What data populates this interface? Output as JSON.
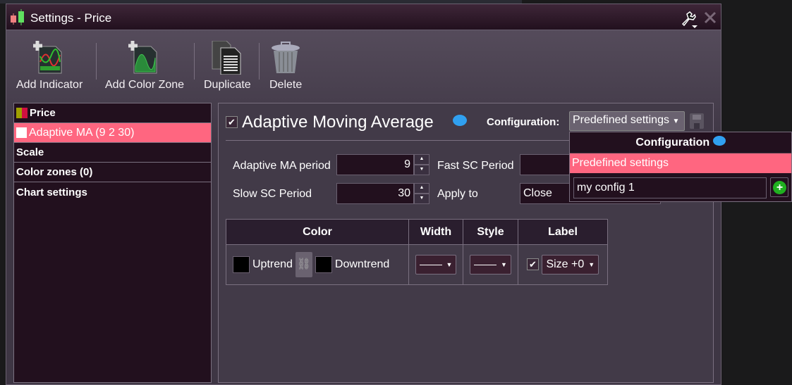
{
  "window": {
    "title": "Settings - Price"
  },
  "toolbar": [
    {
      "label": "Add Indicator",
      "icon": "add-indicator-icon"
    },
    {
      "label": "Add Color Zone",
      "icon": "add-color-zone-icon"
    },
    {
      "label": "Duplicate",
      "icon": "duplicate-icon"
    },
    {
      "label": "Delete",
      "icon": "trash-icon"
    }
  ],
  "tree": {
    "items": [
      {
        "label": "Price",
        "selected": false
      },
      {
        "label": "Adaptive MA (9 2 30)",
        "selected": true
      },
      {
        "label": "Scale"
      },
      {
        "label": "Color zones (0)"
      },
      {
        "label": "Chart settings"
      }
    ]
  },
  "indicator": {
    "enabled": true,
    "title": "Adaptive Moving Average",
    "config_label": "Configuration:",
    "config_value": "Predefined settings",
    "fields": {
      "ama_label": "Adaptive MA period",
      "ama_value": "9",
      "fast_label": "Fast SC Period",
      "fast_value": "",
      "slow_label": "Slow SC Period",
      "slow_value": "30",
      "apply_label": "Apply to",
      "apply_value": "Close"
    },
    "table": {
      "headers": [
        "Color",
        "Width",
        "Style",
        "Label"
      ],
      "uptrend": "Uptrend",
      "downtrend": "Downtrend",
      "uptrend_color": "#000000",
      "downtrend_color": "#000000",
      "label_checked": true,
      "size": "Size +0"
    }
  },
  "popup": {
    "title": "Configuration",
    "option": "Predefined settings",
    "input_value": "my config 1"
  },
  "colors": {
    "accent": "#ff6680",
    "panel": "#22101e"
  }
}
